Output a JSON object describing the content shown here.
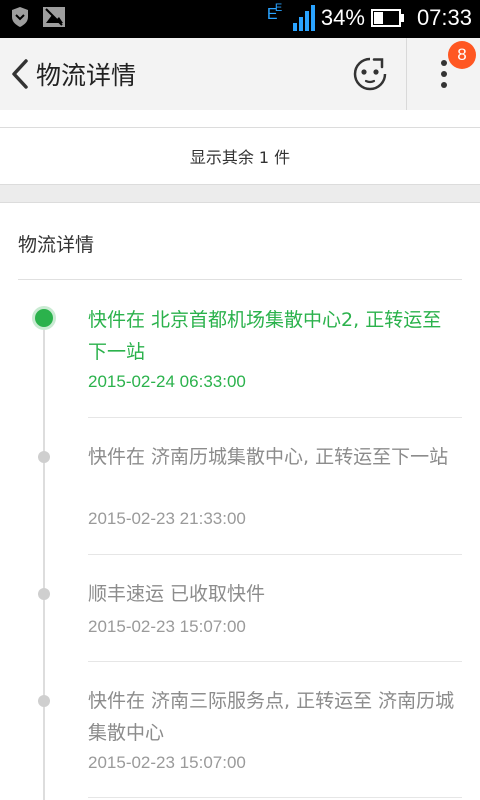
{
  "status_bar": {
    "battery": "34%",
    "time": "07:33",
    "network": "E",
    "icons": [
      "shield-icon",
      "image-icon",
      "signal-icon",
      "battery-icon"
    ]
  },
  "app_bar": {
    "title": "物流详情",
    "badge_count": "8",
    "icons": [
      "back-arrow-icon",
      "face-icon",
      "more-vert-icon"
    ]
  },
  "show_rest": {
    "label": "显示其余 1 件"
  },
  "detail": {
    "title": "物流详情",
    "entries": [
      {
        "text": "快件在 北京首都机场集散中心2, 正转运至下一站",
        "time": "2015-02-24 06:33:00"
      },
      {
        "text": "快件在 济南历城集散中心, 正转运至下一站",
        "time": "2015-02-23 21:33:00"
      },
      {
        "text": "顺丰速运 已收取快件",
        "time": "2015-02-23 15:07:00"
      },
      {
        "text": "快件在 济南三际服务点, 正转运至 济南历城集散中心",
        "time": "2015-02-23 15:07:00"
      }
    ]
  },
  "colors": {
    "accent": "#2bb24c",
    "badge": "#ff5722",
    "muted": "#8c8c8c"
  }
}
